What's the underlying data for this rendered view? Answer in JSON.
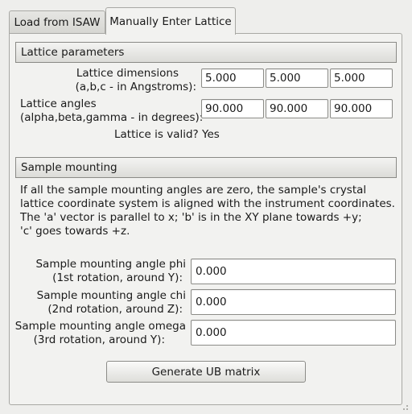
{
  "tabs": [
    {
      "label": "Load from ISAW"
    },
    {
      "label": "Manually Enter Lattice"
    }
  ],
  "lattice": {
    "header": "Lattice parameters",
    "dimensions_label_1": "Lattice dimensions",
    "dimensions_label_2": "(a,b,c - in Angstroms):",
    "a": "5.000",
    "b": "5.000",
    "c": "5.000",
    "angles_label_1": "Lattice angles",
    "angles_label_2": "(alpha,beta,gamma - in degrees):",
    "alpha": "90.000",
    "beta": "90.000",
    "gamma": "90.000",
    "valid_label": "Lattice is valid?",
    "valid_value": "Yes"
  },
  "mounting": {
    "header": "Sample mounting",
    "description_1": "If all the sample mounting angles are zero, the sample's crystal",
    "description_2": "lattice coordinate system is aligned with the instrument coordinates.",
    "description_3": "The 'a' vector is parallel to x; 'b' is in the XY plane towards +y;",
    "description_4": "'c' goes towards +z.",
    "phi_label_1": "Sample mounting angle phi",
    "phi_label_2": "(1st rotation, around Y):",
    "phi": "0.000",
    "chi_label_1": "Sample mounting angle chi",
    "chi_label_2": "(2nd rotation, around Z):",
    "chi": "0.000",
    "omega_label_1": "Sample mounting angle omega",
    "omega_label_2": "(3rd rotation, around Y):",
    "omega": "0.000"
  },
  "generate_button": "Generate UB matrix"
}
